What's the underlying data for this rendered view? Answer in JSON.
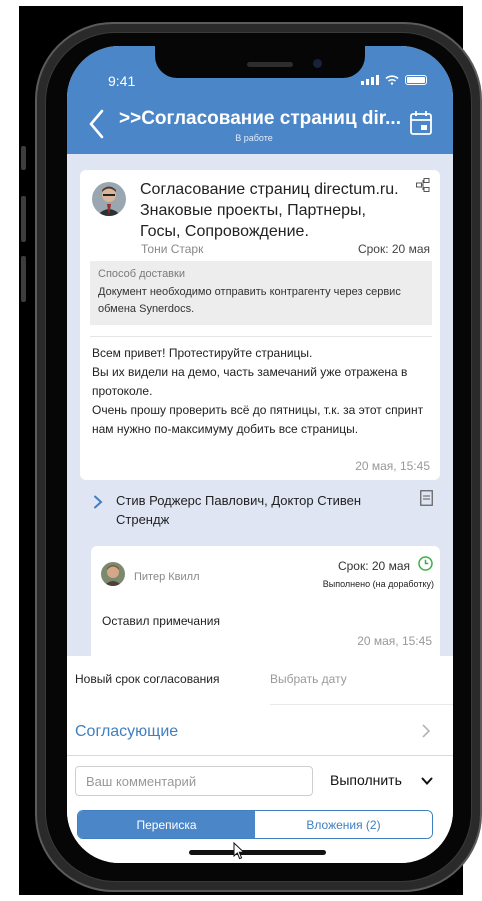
{
  "status_bar": {
    "time": "9:41"
  },
  "header": {
    "title": ">>Согласование страниц dir...",
    "subtitle": "В работе"
  },
  "task": {
    "title": "Согласование страниц directum.ru. Знаковые проекты, Партнеры, Госы, Сопровождение.",
    "author": "Тони Старк",
    "deadline": "Срок: 20 мая",
    "delivery_label": "Способ доставки",
    "delivery_text": "Документ необходимо отправить контрагенту через сервис обмена Synerdocs.",
    "message": "Всем привет! Протестируйте страницы.\nВы их видели на демо, часть замечаний уже отражена в протоколе.\nОчень прошу проверить всё до пятницы, т.к. за этот спринт нам нужно по-максимуму добить все страницы.",
    "message_time": "20 мая, 15:45"
  },
  "assignees": {
    "text": "Стив Роджерс Павлович, Доктор Стивен Стрендж"
  },
  "subtask": {
    "author": "Питер Квилл",
    "deadline": "Срок: 20 мая",
    "status": "Выполнено (на доработку)",
    "note": "Оставил примечания",
    "time": "20 мая, 15:45"
  },
  "form": {
    "new_deadline_label": "Новый срок согласования",
    "pick_date": "Выбрать дату",
    "approvers_label": "Согласующие",
    "comment_placeholder": "Ваш комментарий",
    "execute_label": "Выполнить"
  },
  "tabs": [
    {
      "label": "Переписка",
      "active": true
    },
    {
      "label": "Вложения (2)",
      "active": false
    }
  ],
  "colors": {
    "accent": "#4b86c8",
    "background": "#dfe5f2",
    "status_green": "#3cb043"
  },
  "icons": [
    "back-chevron-icon",
    "calendar-icon",
    "task-tree-icon",
    "expand-chevron-icon",
    "document-icon",
    "clock-check-icon",
    "chevron-right-icon",
    "chevron-down-icon",
    "mouse-cursor-icon"
  ]
}
